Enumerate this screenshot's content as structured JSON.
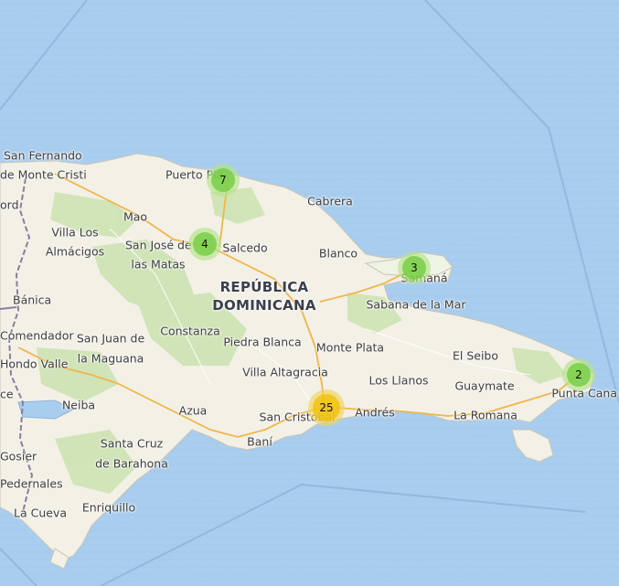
{
  "map": {
    "country_label_line1": "REPÚBLICA",
    "country_label_line2": "DOMINICANA",
    "places": {
      "san_fernando": "San Fernando",
      "de_monte_cristi": "de Monte Cristi",
      "ord": "ord",
      "villa_los": "Villa Los",
      "almacigos": "Almácigos",
      "banica": "Bánica",
      "comendador": "Comendador",
      "hondo_valle": "Hondo Valle",
      "ce": "ce",
      "gosier": "Gosier",
      "pedernales": "Pedernales",
      "la_cueva": "La Cueva",
      "puerto_plata": "Puerto Pla",
      "mao": "Mao",
      "san_jose_de": "San José de",
      "las_matas": "las Matas",
      "salcedo": "Salcedo",
      "cabrera": "Cabrera",
      "blanco": "Blanco",
      "samana": "Samaná",
      "sabana_de_la_mar": "Sabana de la Mar",
      "constanza": "Constanza",
      "san_juan_de": "San Juan de",
      "la_maguana": "la Maguana",
      "piedra_blanca": "Piedra Blanca",
      "monte_plata": "Monte Plata",
      "villa_altagracia": "Villa Altagracia",
      "el_seibo": "El Seibo",
      "los_llanos": "Los Llanos",
      "guaymate": "Guaymate",
      "punta_cana": "Punta Cana",
      "neiba": "Neiba",
      "azua": "Azua",
      "san_cristobal": "San Cristóbal",
      "andres": "Andrés",
      "la_romana": "La Romana",
      "bani": "Baní",
      "santa_cruz": "Santa Cruz",
      "de_barahona": "de Barahona",
      "enriquillo": "Enriquillo"
    },
    "clusters": [
      {
        "id": "puerto-plata",
        "count": "7",
        "color": "green"
      },
      {
        "id": "santiago",
        "count": "4",
        "color": "green"
      },
      {
        "id": "samana",
        "count": "3",
        "color": "green"
      },
      {
        "id": "punta-cana",
        "count": "2",
        "color": "green"
      },
      {
        "id": "santo-domingo",
        "count": "25",
        "color": "yellow"
      }
    ]
  },
  "colors": {
    "sea": "#a9cdee",
    "land": "#f3f0e6",
    "forest": "#cde3b4",
    "cluster_green": "#6ecc39",
    "cluster_yellow": "#f0c20c"
  }
}
